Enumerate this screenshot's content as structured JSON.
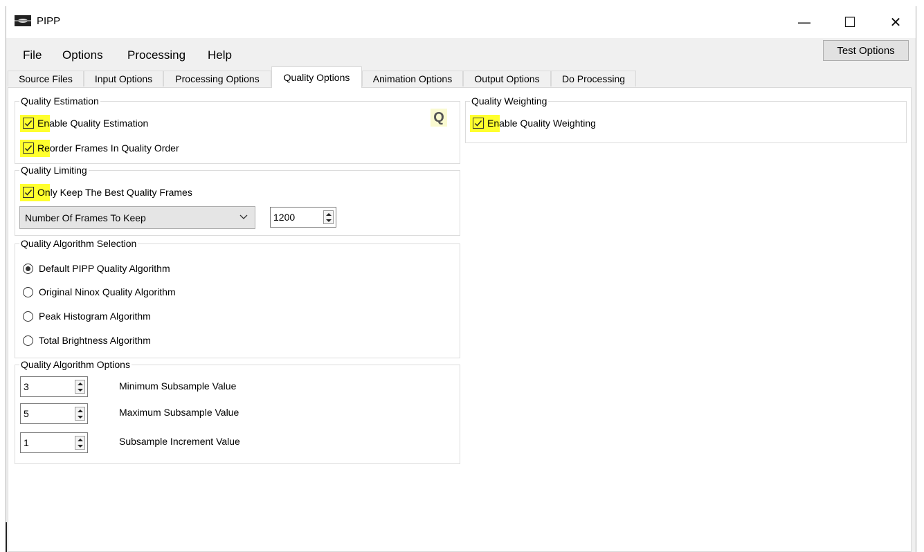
{
  "window": {
    "title": "PIPP"
  },
  "titlebar_buttons": {
    "minimize": "—",
    "maximize": "☐",
    "close": "✕"
  },
  "menu": {
    "items": [
      "File",
      "Options",
      "Processing",
      "Help"
    ],
    "test_options": "Test Options"
  },
  "tabs": [
    "Source Files",
    "Input Options",
    "Processing Options",
    "Quality Options",
    "Animation Options",
    "Output Options",
    "Do Processing"
  ],
  "active_tab": "Quality Options",
  "quality_estimation": {
    "label": "Quality Estimation",
    "enable_label": "Enable Quality Estimation",
    "enable_checked": true,
    "reorder_label": "Reorder Frames In Quality Order",
    "reorder_checked": true,
    "q_icon": "Q"
  },
  "quality_limiting": {
    "label": "Quality Limiting",
    "keep_best_label": "Only Keep The Best Quality Frames",
    "keep_best_checked": true,
    "mode_selected": "Number Of Frames To Keep",
    "frames_value": "1200"
  },
  "algorithm_selection": {
    "label": "Quality Algorithm Selection",
    "options": [
      "Default PIPP Quality Algorithm",
      "Original Ninox Quality Algorithm",
      "Peak Histogram Algorithm",
      "Total Brightness Algorithm"
    ],
    "selected": "Default PIPP Quality Algorithm"
  },
  "algorithm_options": {
    "label": "Quality Algorithm Options",
    "min_value": "3",
    "min_label": "Minimum Subsample Value",
    "max_value": "5",
    "max_label": "Maximum Subsample Value",
    "inc_value": "1",
    "inc_label": "Subsample Increment Value"
  },
  "quality_weighting": {
    "label": "Quality Weighting",
    "enable_label": "Enable Quality Weighting",
    "enable_checked": true
  },
  "colors": {
    "highlight": "#ffff2e",
    "panel": "#ffffff",
    "chrome": "#f0f0f0"
  }
}
